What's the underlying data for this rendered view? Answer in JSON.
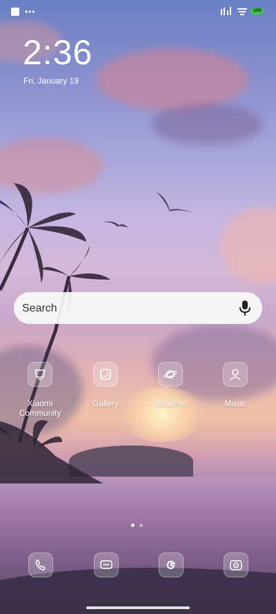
{
  "status_bar": {
    "notification_dots": "•••",
    "battery_level": "100"
  },
  "lock": {
    "time": "2:36",
    "date": "Fri, January 19"
  },
  "search": {
    "placeholder": "Search"
  },
  "apps": [
    {
      "label": "Xiaomi Community",
      "icon": "xiaomi-community-icon"
    },
    {
      "label": "Gallery",
      "icon": "gallery-icon"
    },
    {
      "label": "Weather",
      "icon": "weather-icon"
    },
    {
      "label": "Music",
      "icon": "music-icon"
    }
  ],
  "page_indicator": {
    "pages": 2,
    "current": 1
  },
  "dock": [
    {
      "icon": "phone-icon"
    },
    {
      "icon": "messages-icon"
    },
    {
      "icon": "google-icon"
    },
    {
      "icon": "camera-icon"
    }
  ],
  "colors": {
    "battery": "#3ec24d",
    "search_bg": "#fafafa"
  }
}
